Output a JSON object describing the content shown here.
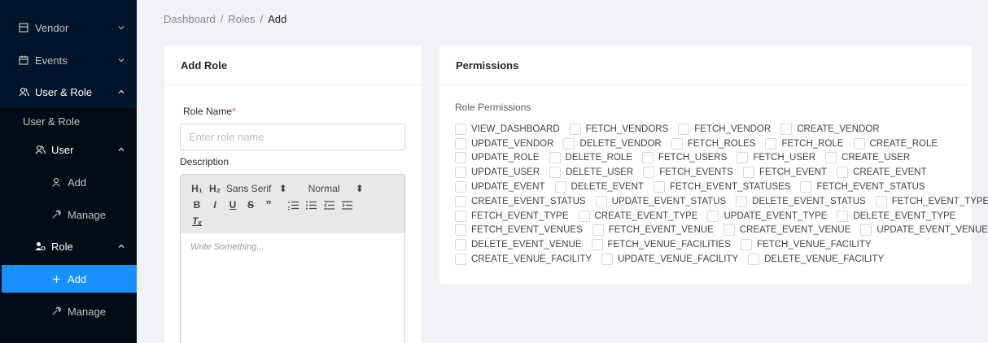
{
  "sidebar": {
    "vendor": "Vendor",
    "events": "Events",
    "user_role": "User & Role",
    "user_role_sub": "User & Role",
    "user": "User",
    "user_add": "Add",
    "user_manage": "Manage",
    "role": "Role",
    "role_add": "Add",
    "role_manage": "Manage"
  },
  "breadcrumb": [
    "Dashboard",
    "Roles",
    "Add"
  ],
  "add_role": {
    "title": "Add Role",
    "role_name_label": "Role Name",
    "required_mark": "*",
    "role_name_placeholder": "Enter role name",
    "description_label": "Description",
    "toolbar": {
      "h1": "H₁",
      "h2": "H₂",
      "font": "Sans Serif",
      "size": "Normal",
      "bold": "B",
      "italic": "I",
      "underline": "U",
      "strike": "S",
      "quote": "”",
      "clean": "Tₓ"
    },
    "editor_placeholder": "Write Something..."
  },
  "permissions": {
    "title": "Permissions",
    "subtitle": "Role Permissions",
    "rows": [
      [
        "VIEW_DASHBOARD",
        "FETCH_VENDORS",
        "FETCH_VENDOR",
        "CREATE_VENDOR"
      ],
      [
        "UPDATE_VENDOR",
        "DELETE_VENDOR",
        "FETCH_ROLES",
        "FETCH_ROLE",
        "CREATE_ROLE"
      ],
      [
        "UPDATE_ROLE",
        "DELETE_ROLE",
        "FETCH_USERS",
        "FETCH_USER",
        "CREATE_USER"
      ],
      [
        "UPDATE_USER",
        "DELETE_USER",
        "FETCH_EVENTS",
        "FETCH_EVENT",
        "CREATE_EVENT"
      ],
      [
        "UPDATE_EVENT",
        "DELETE_EVENT",
        "FETCH_EVENT_STATUSES",
        "FETCH_EVENT_STATUS"
      ],
      [
        "CREATE_EVENT_STATUS",
        "UPDATE_EVENT_STATUS",
        "DELETE_EVENT_STATUS",
        "FETCH_EVENT_TYPES"
      ],
      [
        "FETCH_EVENT_TYPE",
        "CREATE_EVENT_TYPE",
        "UPDATE_EVENT_TYPE",
        "DELETE_EVENT_TYPE"
      ],
      [
        "FETCH_EVENT_VENUES",
        "FETCH_EVENT_VENUE",
        "CREATE_EVENT_VENUE",
        "UPDATE_EVENT_VENUE"
      ],
      [
        "DELETE_EVENT_VENUE",
        "FETCH_VENUE_FACILITIES",
        "FETCH_VENUE_FACILITY"
      ],
      [
        "CREATE_VENUE_FACILITY",
        "UPDATE_VENUE_FACILITY",
        "DELETE_VENUE_FACILITY"
      ]
    ]
  },
  "colors": {
    "sidebar": "#001529",
    "submenu": "#000c17",
    "active": "#1890ff"
  }
}
